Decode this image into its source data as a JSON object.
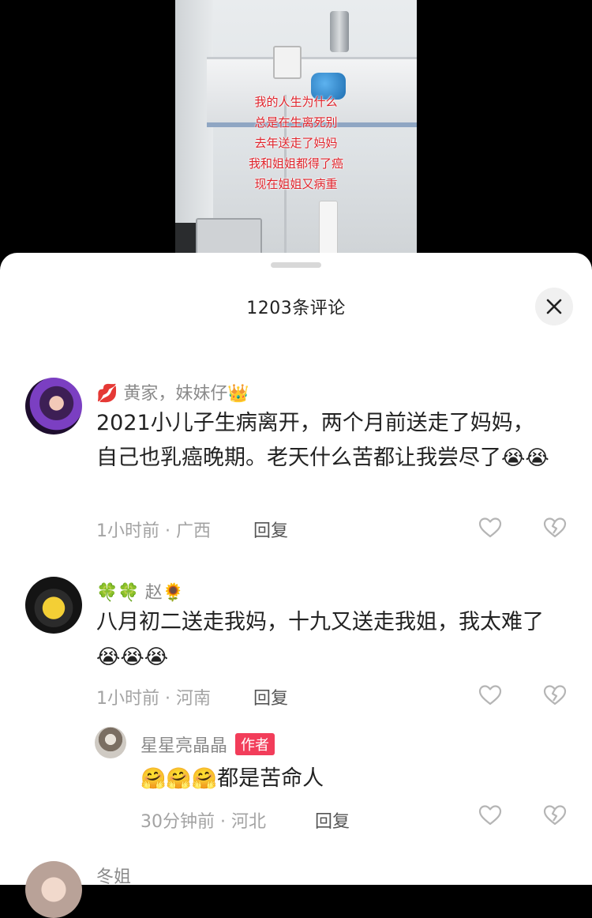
{
  "video": {
    "caption_lines": [
      "我的人生为什么",
      "总是在生离死别",
      "去年送走了妈妈",
      "我和姐姐都得了癌",
      "现在姐姐又病重"
    ]
  },
  "sheet": {
    "title": "1203条评论",
    "close_icon": "close-icon"
  },
  "comments": [
    {
      "name_prefix_emoji": "💋",
      "name": "黄家，妹妹仔",
      "name_suffix_emoji": "👑",
      "text": "2021小儿子生病离开，两个月前送走了妈妈，自己也乳癌晚期。老天什么苦都让我尝尽了",
      "text_emojis": "😭😭",
      "meta": "1小时前 · 广西",
      "reply_label": "回复"
    },
    {
      "name_prefix_emoji": "🍀🍀",
      "name": "赵",
      "name_suffix_emoji": "🌻",
      "text": "八月初二送走我妈，十九又送走我姐，我太难了",
      "text_emojis": "😭😭😭",
      "meta": "1小时前 · 河南",
      "reply_label": "回复"
    }
  ],
  "reply": {
    "name": "星星亮晶晶",
    "badge": "作者",
    "text_emojis": "🤗🤗🤗",
    "text": "都是苦命人",
    "meta": "30分钟前 · 河北",
    "reply_label": "回复"
  },
  "partial_comment": {
    "name": "冬姐"
  },
  "icons": {
    "like": "heart-outline-icon",
    "dislike": "broken-heart-icon",
    "accent_color": "#f23d5a"
  }
}
